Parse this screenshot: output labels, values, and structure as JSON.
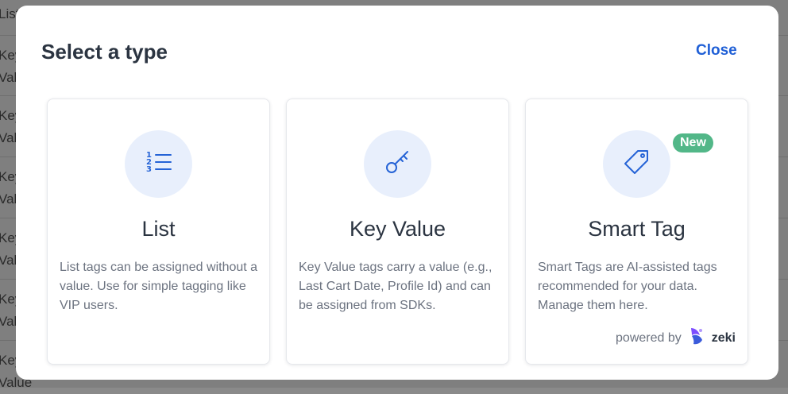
{
  "background": {
    "rows": [
      "List",
      "Key\nValue",
      "Key\nValue",
      "Key\nValue",
      "Key\nValue",
      "Key\nValue",
      "Key\nValue"
    ]
  },
  "modal": {
    "title": "Select a type",
    "close_label": "Close",
    "cards": [
      {
        "title": "List",
        "description": "List tags can be assigned without a value. Use for simple tagging like VIP users.",
        "icon": "numbered-list-icon"
      },
      {
        "title": "Key Value",
        "description": "Key Value tags carry a value (e.g., Last Cart Date, Profile Id) and can be assigned from SDKs.",
        "icon": "key-icon"
      },
      {
        "title": "Smart Tag",
        "description": "Smart Tags are AI-assisted tags recommended for your data. Manage them here.",
        "icon": "tag-icon",
        "badge": "New",
        "powered_by_label": "powered by",
        "powered_by_brand": "zeki"
      }
    ]
  },
  "colors": {
    "accent": "#1f5fd6",
    "icon_bg": "#e8effc",
    "badge": "#52b788",
    "title_text": "#2b3441",
    "muted_text": "#6c7380"
  }
}
